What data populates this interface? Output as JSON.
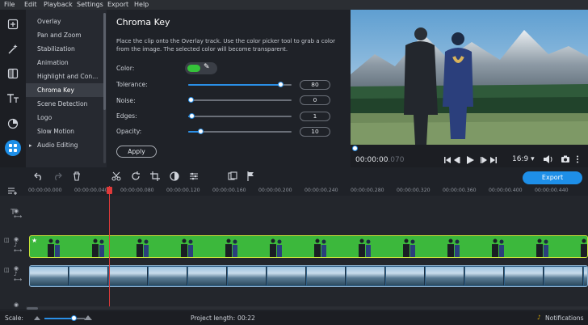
{
  "menu": [
    "File",
    "Edit",
    "Playback",
    "Settings",
    "Export",
    "Help"
  ],
  "sidebar_tools": [
    "import-icon",
    "magic-wand-icon",
    "filters-icon",
    "text-icon",
    "transitions-icon",
    "more-tools-icon"
  ],
  "submenu": [
    "Overlay",
    "Pan and Zoom",
    "Stabilization",
    "Animation",
    "Highlight and Con...",
    "Chroma Key",
    "Scene Detection",
    "Logo",
    "Slow Motion",
    "Audio Editing"
  ],
  "submenu_expander": "▸",
  "panel": {
    "title": "Chroma Key",
    "description": "Place the clip onto the Overlay track. Use the color picker tool to grab a color from the image. The selected color will become transparent.",
    "color_label": "Color:",
    "key_color": "#35c23a",
    "picker_glyph": "✎",
    "sliders": [
      {
        "label": "Tolerance:",
        "value": "80",
        "fraction": 0.89
      },
      {
        "label": "Noise:",
        "value": "0",
        "fraction": 0.02
      },
      {
        "label": "Edges:",
        "value": "1",
        "fraction": 0.03
      },
      {
        "label": "Opacity:",
        "value": "10",
        "fraction": 0.12
      }
    ],
    "apply_label": "Apply"
  },
  "player": {
    "timecode": "00:00:00",
    "timecode_ms": ".070",
    "aspect": "16:9 ▾"
  },
  "toolbar": {
    "export_label": "Export"
  },
  "ruler": [
    "00:00:00.000",
    "00:00:00.040",
    "00:00:00.080",
    "00:00:00.120",
    "00:00:00.160",
    "00:00:00.200",
    "00:00:00.240",
    "00:00:00.280",
    "00:00:00.320",
    "00:00:00.360",
    "00:00:00.400",
    "00:00:00.440"
  ],
  "status": {
    "scale_label": "Scale:",
    "scale_fraction": 0.72,
    "project_length_label": "Project length:",
    "project_length": "00:22",
    "notifications": "Notifications"
  },
  "colors": {
    "accent": "#1e8fe8",
    "playhead": "#e03a3a",
    "overlay_clip": "#3cb83c",
    "clip_border": "#c7e43a"
  }
}
